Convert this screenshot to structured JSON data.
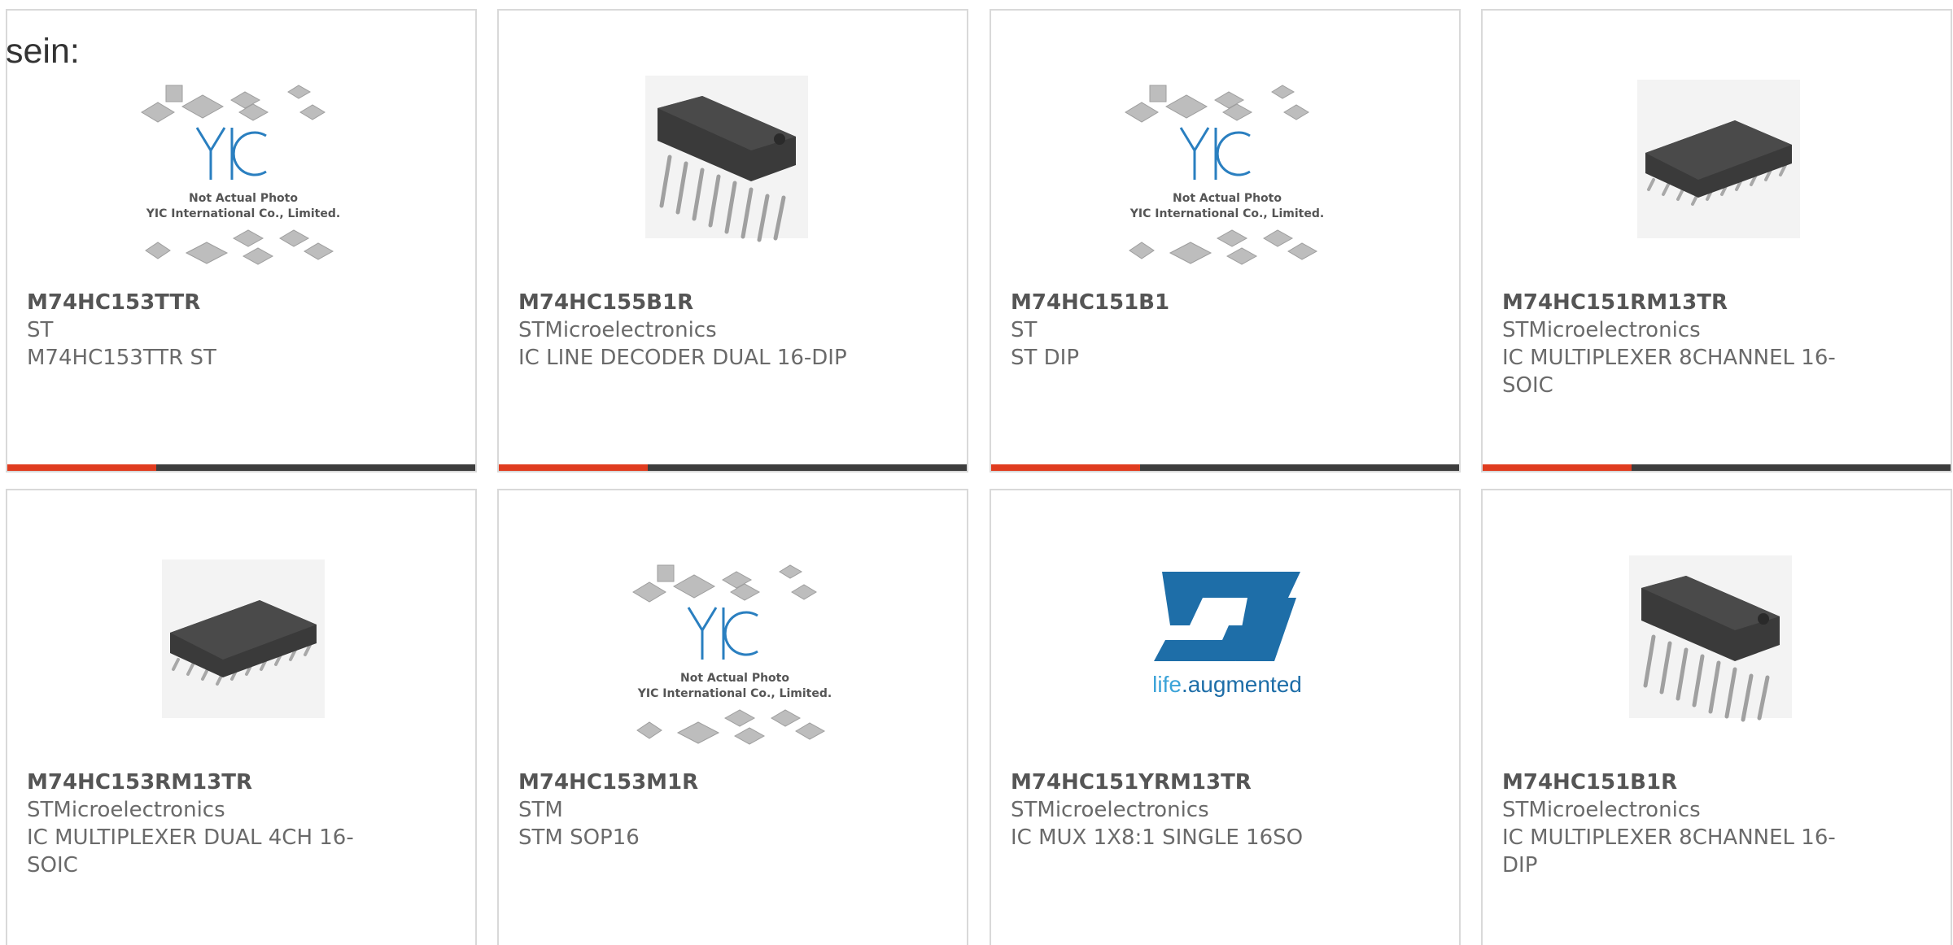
{
  "intro_text": "sein:",
  "products": [
    {
      "part_number": "M74HC153TTR",
      "manufacturer": "ST",
      "description": "M74HC153TTR ST",
      "image": "yic-placeholder",
      "placeholder_line1": "Not Actual Photo",
      "placeholder_line2": "YIC International Co., Limited."
    },
    {
      "part_number": "M74HC155B1R",
      "manufacturer": "STMicroelectronics",
      "description": "IC LINE DECODER DUAL 16-DIP",
      "image": "dip16-chip"
    },
    {
      "part_number": "M74HC151B1",
      "manufacturer": "ST",
      "description": "ST DIP",
      "image": "yic-placeholder",
      "placeholder_line1": "Not Actual Photo",
      "placeholder_line2": "YIC International Co., Limited."
    },
    {
      "part_number": "M74HC151RM13TR",
      "manufacturer": "STMicroelectronics",
      "description": "IC MULTIPLEXER 8CHANNEL 16-SOIC",
      "image": "soic16-chip"
    },
    {
      "part_number": "M74HC153RM13TR",
      "manufacturer": "STMicroelectronics",
      "description": "IC MULTIPLEXER DUAL 4CH 16-SOIC",
      "image": "soic16-chip"
    },
    {
      "part_number": "M74HC153M1R",
      "manufacturer": "STM",
      "description": "STM SOP16",
      "image": "yic-placeholder",
      "placeholder_line1": "Not Actual Photo",
      "placeholder_line2": "YIC International Co., Limited."
    },
    {
      "part_number": "M74HC151YRM13TR",
      "manufacturer": "STMicroelectronics",
      "description": "IC MUX 1X8:1 SINGLE 16SO",
      "image": "st-logo",
      "logo_tagline_a": "life",
      "logo_tagline_b": ".augmented"
    },
    {
      "part_number": "M74HC151B1R",
      "manufacturer": "STMicroelectronics",
      "description": "IC MULTIPLEXER 8CHANNEL 16-DIP",
      "image": "dip16-chip"
    }
  ],
  "colors": {
    "accent": "#e03c1f",
    "bar": "#3d3d3d",
    "border": "#d9d9d9",
    "st_blue": "#1e6ea8",
    "yic_blue": "#2a7fc0"
  }
}
